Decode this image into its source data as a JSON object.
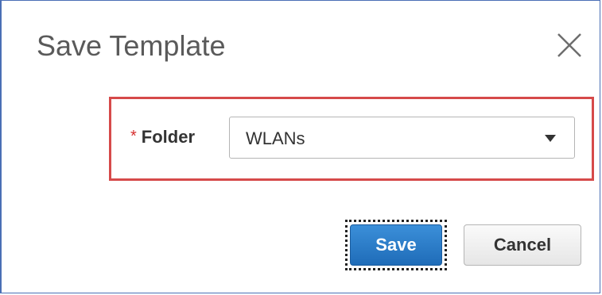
{
  "dialog": {
    "title": "Save Template",
    "close_icon": "close-icon"
  },
  "form": {
    "folder": {
      "required_marker": "*",
      "label": "Folder",
      "selected_value": "WLANs",
      "caret_icon": "caret-down-icon"
    }
  },
  "actions": {
    "save_label": "Save",
    "cancel_label": "Cancel"
  },
  "colors": {
    "highlight_border": "#d64a4a",
    "primary_button": "#2a7cc9",
    "dialog_border": "#4a6fb5",
    "required_marker": "#d62f2f"
  }
}
